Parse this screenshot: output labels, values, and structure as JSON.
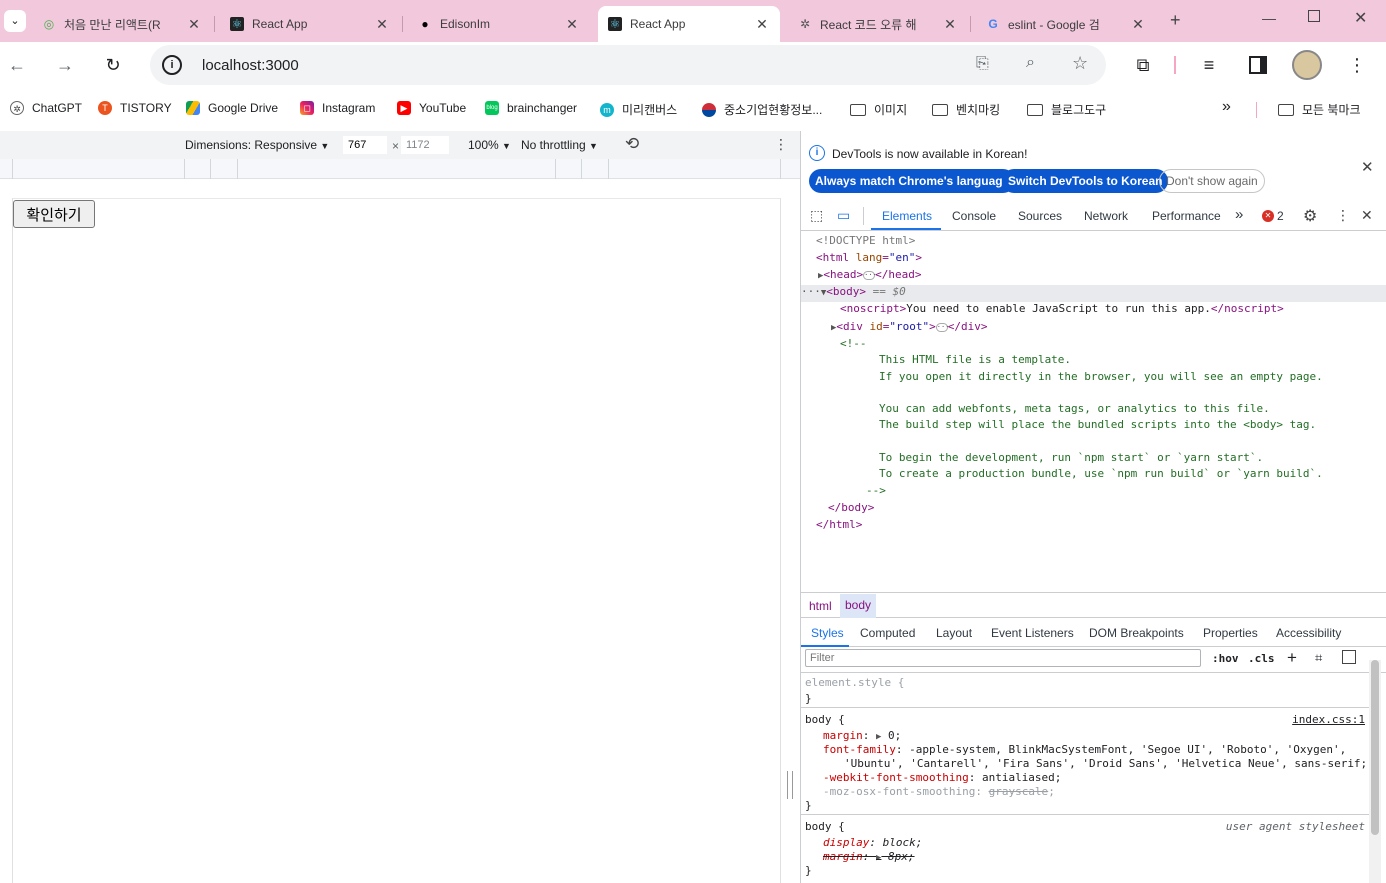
{
  "browser": {
    "tabs": [
      {
        "title": "처음 만난 리액트(R",
        "favicon": "android-icon",
        "active": false
      },
      {
        "title": "React App",
        "favicon": "react-icon",
        "active": false
      },
      {
        "title": "EdisonIm",
        "favicon": "github-icon",
        "active": false
      },
      {
        "title": "React App",
        "favicon": "react-icon",
        "active": true
      },
      {
        "title": "React 코드 오류 해",
        "favicon": "openai-icon",
        "active": false
      },
      {
        "title": "eslint - Google 검",
        "favicon": "google-icon",
        "active": false
      }
    ],
    "new_tab": "+",
    "url": "localhost:3000",
    "bookmarks": [
      {
        "label": "ChatGPT",
        "icon": "openai-icon"
      },
      {
        "label": "TISTORY",
        "icon": "tistory-icon"
      },
      {
        "label": "Google Drive",
        "icon": "drive-icon"
      },
      {
        "label": "Instagram",
        "icon": "instagram-icon"
      },
      {
        "label": "YouTube",
        "icon": "youtube-icon"
      },
      {
        "label": "brainchanger",
        "icon": "blog-icon"
      },
      {
        "label": "미리캔버스",
        "icon": "miricanvas-icon"
      },
      {
        "label": "중소기업현황정보...",
        "icon": "korea-gov-icon"
      },
      {
        "label": "이미지",
        "icon": "folder-icon"
      },
      {
        "label": "벤치마킹",
        "icon": "folder-icon"
      },
      {
        "label": "블로그도구",
        "icon": "folder-icon"
      }
    ],
    "bookmarks_overflow": "»",
    "all_bookmarks": "모든 북마크"
  },
  "device_toolbar": {
    "dimensions": "Dimensions: Responsive",
    "width": "767",
    "times": "×",
    "height": "1172",
    "zoom": "100%",
    "throttling": "No throttling"
  },
  "page": {
    "button_label": "확인하기"
  },
  "devtools": {
    "infobar": {
      "message": "DevTools is now available in Korean!",
      "btn_match": "Always match Chrome's language",
      "btn_switch": "Switch DevTools to Korean",
      "btn_dismiss": "Don't show again"
    },
    "tabs": [
      "Elements",
      "Console",
      "Sources",
      "Network",
      "Performance"
    ],
    "error_count": "2",
    "dom": {
      "doctype": "<!DOCTYPE html>",
      "html_open_tag": "<html",
      "html_attr": "lang",
      "html_attr_val": "\"en\"",
      "head_open": "<head>",
      "head_close": "</head>",
      "body_open": "<body>",
      "body_sel": "== $0",
      "noscript_open": "<noscript>",
      "noscript_text": "You need to enable JavaScript to run this app.",
      "noscript_close": "</noscript>",
      "div_open": "<div",
      "div_attr": "id",
      "div_attr_val": "\"root\"",
      "div_close": "</div>",
      "comment_open": "<!--",
      "comment_lines": [
        "This HTML file is a template.",
        "If you open it directly in the browser, you will see an empty page.",
        "",
        "You can add webfonts, meta tags, or analytics to this file.",
        "The build step will place the bundled scripts into the <body> tag.",
        "",
        "To begin the development, run `npm start` or `yarn start`.",
        "To create a production bundle, use `npm run build` or `yarn build`."
      ],
      "comment_close": "-->",
      "body_close": "</body>",
      "html_close": "</html>"
    },
    "breadcrumbs": [
      "html",
      "body"
    ],
    "styles_tabs": [
      "Styles",
      "Computed",
      "Layout",
      "Event Listeners",
      "DOM Breakpoints",
      "Properties",
      "Accessibility"
    ],
    "filter_placeholder": "Filter",
    "hov": ":hov",
    "cls": ".cls",
    "styles": {
      "element_style": "element.style {",
      "close_brace": "}",
      "body_selector": "body {",
      "body_source": "index.css:1",
      "margin_prop": "margin",
      "margin_val": "0;",
      "font_prop": "font-family",
      "font_val1": "-apple-system, BlinkMacSystemFont, 'Segoe UI', 'Roboto', 'Oxygen',",
      "font_val2": "'Ubuntu', 'Cantarell', 'Fira Sans', 'Droid Sans', 'Helvetica Neue', sans-serif;",
      "smooth_prop": "-webkit-font-smoothing",
      "smooth_val": "antialiased;",
      "moz_prop": "-moz-osx-font-smoothing",
      "moz_val": "grayscale",
      "ua_selector": "body {",
      "ua_source": "user agent stylesheet",
      "display_prop": "display",
      "display_val": "block;",
      "ua_margin_prop": "margin",
      "ua_margin_val": "8px;"
    }
  }
}
